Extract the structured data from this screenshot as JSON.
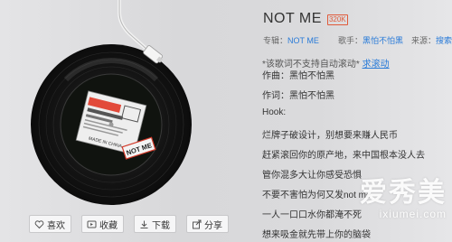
{
  "song": {
    "title": "NOT ME",
    "quality_badge": "320K"
  },
  "meta": {
    "album_label": "专辑：",
    "album": "NOT ME",
    "artist_label": "歌手：",
    "artist": "黑怕不怕黑",
    "source_label": "来源：",
    "source": "搜索页"
  },
  "lyrics": {
    "notice": "*该歌词不支持自动滚动*",
    "notice_link": "求滚动",
    "lines": [
      "作曲：黑怕不怕黑",
      "作词：黑怕不怕黑",
      "Hook:",
      "烂牌子破设计，别想要来赚人民币",
      "赶紧滚回你的原产地，来中国根本没人去",
      "管你混多大让你感受恐惧",
      "不要不害怕为何又发not me",
      "一人一口口水你都淹不死",
      "想来吸金就先带上你的脑袋"
    ]
  },
  "actions": [
    {
      "label": "喜欢",
      "icon": "heart-icon"
    },
    {
      "label": "收藏",
      "icon": "collect-icon"
    },
    {
      "label": "下载",
      "icon": "download-icon"
    },
    {
      "label": "分享",
      "icon": "share-icon"
    }
  ],
  "album_art": {
    "sticker_text": "NOT ME",
    "label_text": "MADE IN CHINA"
  },
  "watermark": {
    "big": "爱秀美",
    "small": "ixiumei.com"
  },
  "colors": {
    "link": "#2a7bd8",
    "badge": "#e05a3a",
    "record": "#1b1b1b"
  }
}
